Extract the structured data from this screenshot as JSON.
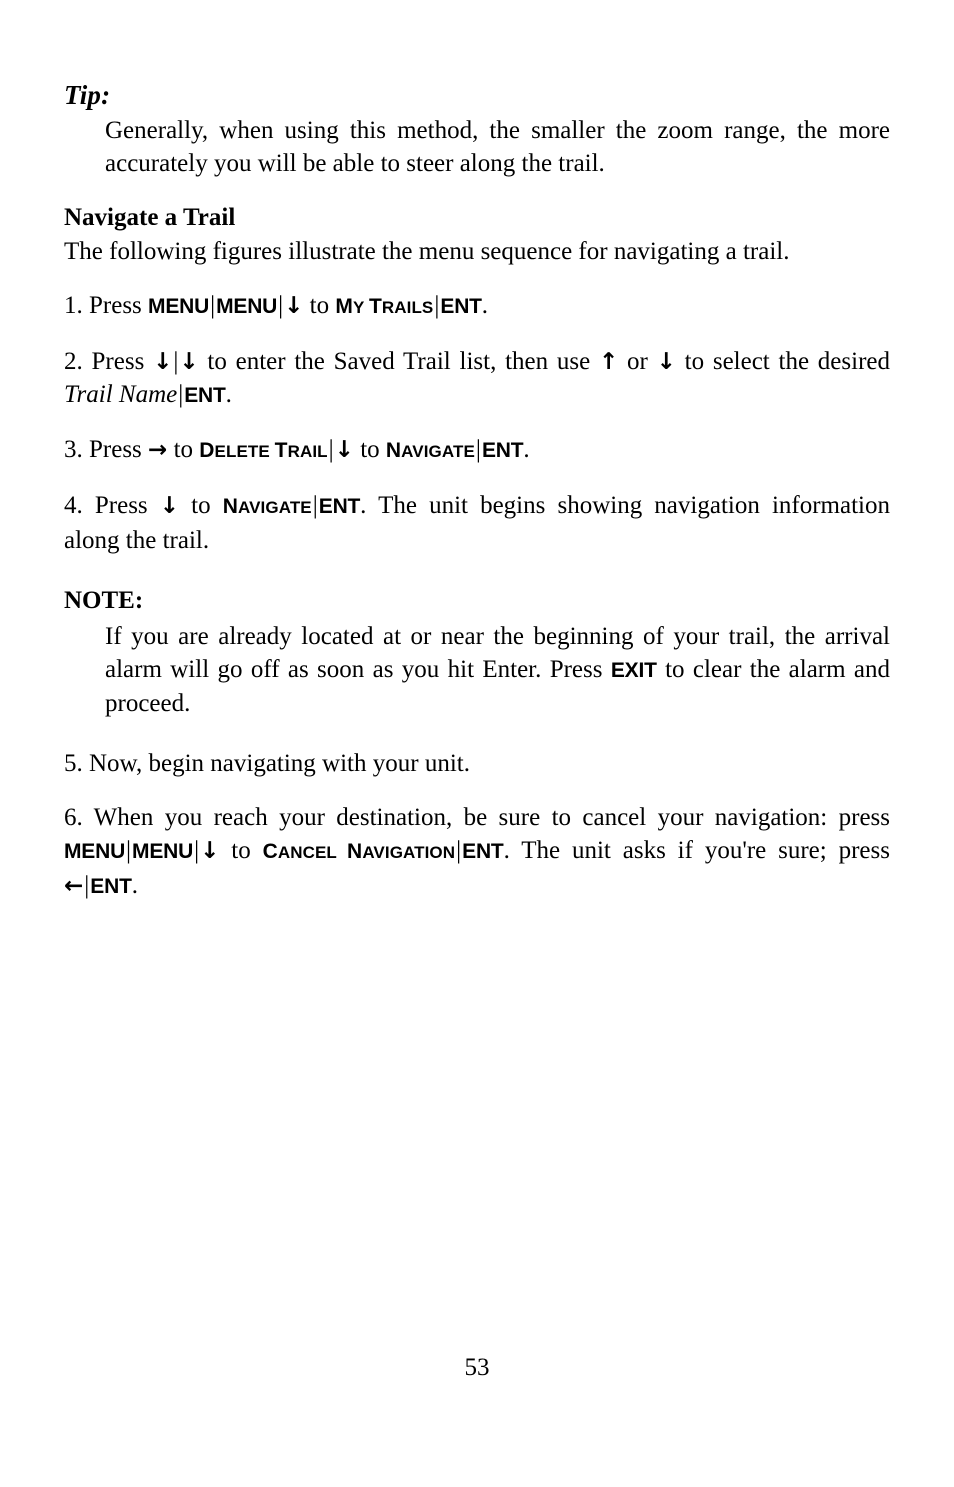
{
  "document": {
    "page_number": "53",
    "page_background": "#ffffff",
    "text_color": "#000000"
  },
  "tip": {
    "heading": "Tip:",
    "body": "Generally, when using this method, the smaller the zoom range, the more accurately you will be able to steer along the trail."
  },
  "section": {
    "heading": "Navigate a Trail",
    "intro": "The following figures illustrate the menu sequence for navigating a trail."
  },
  "steps": {
    "step1": {
      "prefix": "1. Press ",
      "key_menu_1": "MENU",
      "key_menu_2": "MENU",
      "arrow_down": "↓",
      "to": " to ",
      "menu_my_trails_c1": "M",
      "menu_my_trails_r1": "Y ",
      "menu_my_trails_c2": "T",
      "menu_my_trails_r2": "RAILS",
      "key_ent": "ENT",
      "period": "."
    },
    "step2": {
      "prefix": "2. Press ",
      "arrow_down_1": "↓",
      "arrow_down_2": "↓",
      "mid": " to enter the Saved Trail list, then use ",
      "arrow_up": "↑",
      "or": " or ",
      "arrow_down_3": "↓",
      "tail": " to select the desired ",
      "trail_name_italic": "Trail Name",
      "key_ent": "ENT",
      "period": "."
    },
    "step3": {
      "prefix": "3. Press ",
      "arrow_right": "→",
      "to_1": " to ",
      "menu_delete_trail_c1": "D",
      "menu_delete_trail_r1": "ELETE ",
      "menu_delete_trail_c2": "T",
      "menu_delete_trail_r2": "RAIL",
      "arrow_down": "↓",
      "to_2": " to ",
      "menu_navigate_c": "N",
      "menu_navigate_r": "AVIGATE",
      "key_ent": "ENT",
      "period": "."
    },
    "step4": {
      "prefix": "4. Press ",
      "arrow_down": "↓",
      "to": " to ",
      "menu_navigate_c": "N",
      "menu_navigate_r": "AVIGATE",
      "key_ent": "ENT",
      "tail": ". The unit begins showing navigation information along the trail."
    },
    "step5": {
      "text": "5. Now, begin navigating with your unit."
    },
    "step6": {
      "prefix": "6. When you reach your destination, be sure to cancel your navigation: press ",
      "key_menu_1": "MENU",
      "key_menu_2": "MENU",
      "arrow_down": "↓",
      "to": " to ",
      "menu_cancel_c1": "C",
      "menu_cancel_r1": "ANCEL ",
      "menu_cancel_c2": "N",
      "menu_cancel_r2": "AVIGATION",
      "key_ent_1": "ENT",
      "mid": ". The unit asks if you're sure; press ",
      "arrow_left": "←",
      "key_ent_2": "ENT",
      "period": "."
    }
  },
  "note": {
    "heading": "NOTE:",
    "body_before_key": "If you are already located at or near the beginning of your trail, the arrival alarm will go off as soon as you hit Enter. Press ",
    "key_exit": "EXIT",
    "body_after_key": " to clear the alarm and proceed."
  }
}
